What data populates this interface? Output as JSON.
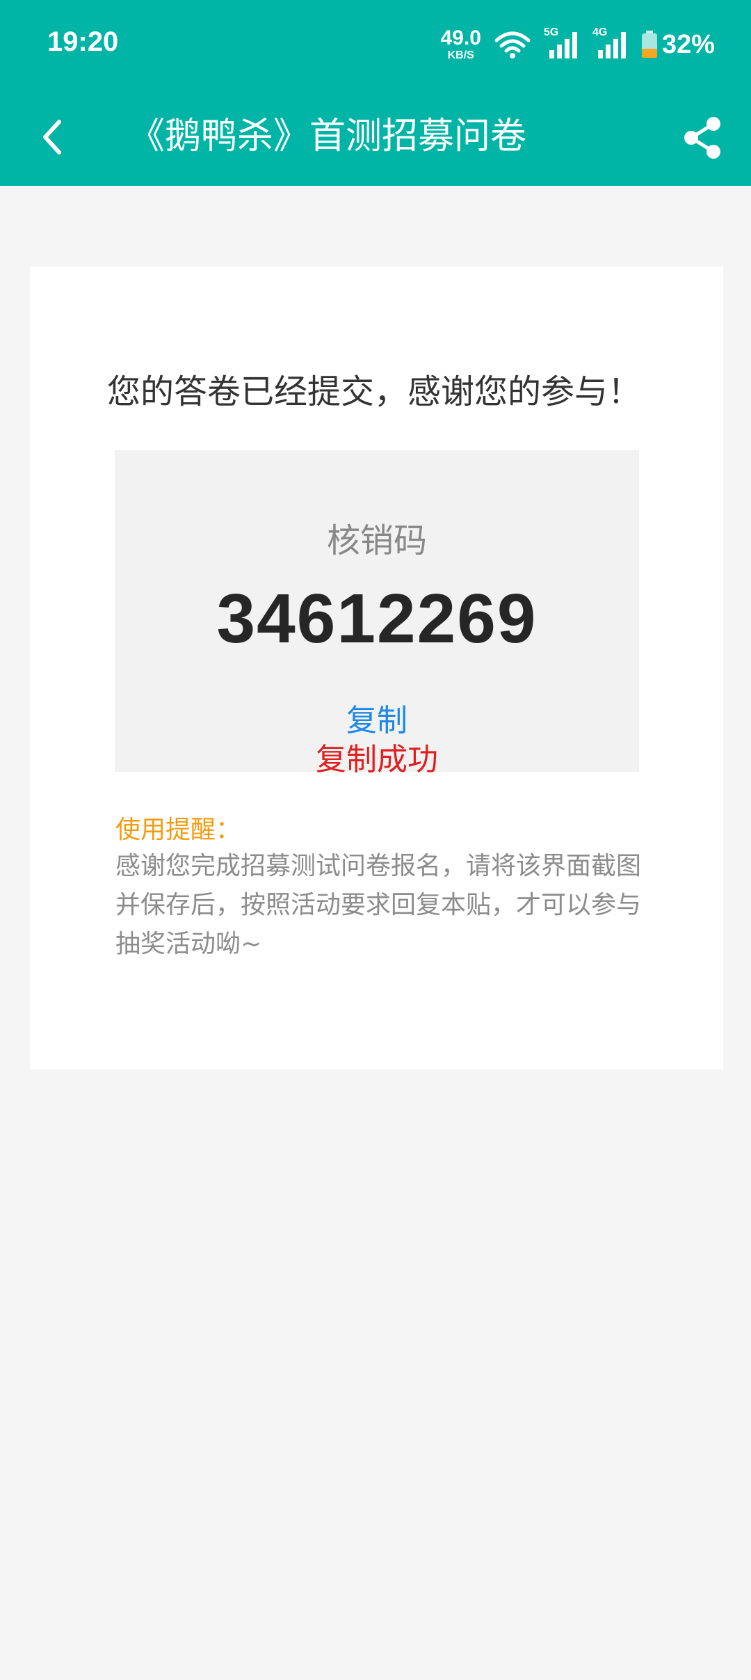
{
  "status_bar": {
    "time": "19:20",
    "net_speed": "49.0",
    "net_unit": "KB/S",
    "signal_1": "5G",
    "signal_2": "4G",
    "battery": "32%"
  },
  "title_bar": {
    "title": "《鹅鸭杀》首测招募问卷",
    "back_icon": "chevron-left-icon",
    "share_icon": "share-icon"
  },
  "card": {
    "message": "您的答卷已经提交，感谢您的参与！",
    "code_label": "核销码",
    "code_value": "34612269",
    "copy_label": "复制",
    "copy_success": "复制成功",
    "reminder_title": "使用提醒：",
    "reminder_text": "感谢您完成招募测试问卷报名，请将该界面截图并保存后，按照活动要求回复本贴，才可以参与抽奖活动呦~"
  },
  "colors": {
    "primary": "#00b5a6",
    "link": "#1e88e5",
    "success": "#e02020",
    "warning": "#f39c12"
  }
}
